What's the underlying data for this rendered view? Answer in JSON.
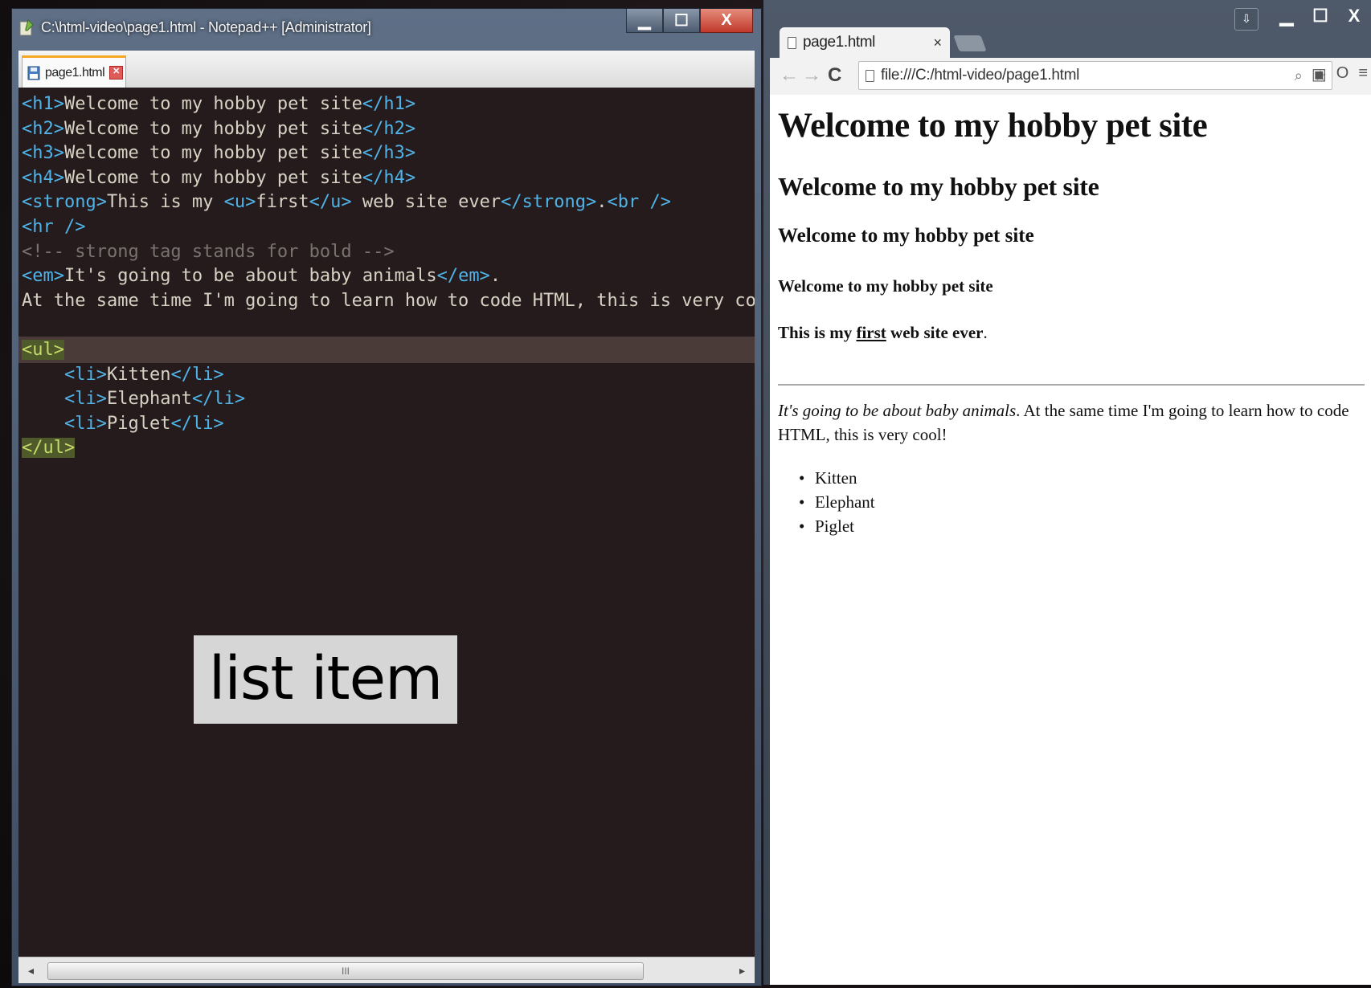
{
  "notepad": {
    "title": "C:\\html-video\\page1.html - Notepad++ [Administrator]",
    "tab_label": "page1.html",
    "code_lines": [
      [
        {
          "t": "<h1>",
          "c": "tag"
        },
        {
          "t": "Welcome to my hobby pet site"
        },
        {
          "t": "</h1>",
          "c": "tag"
        }
      ],
      [
        {
          "t": "<h2>",
          "c": "tag"
        },
        {
          "t": "Welcome to my hobby pet site"
        },
        {
          "t": "</h2>",
          "c": "tag"
        }
      ],
      [
        {
          "t": "<h3>",
          "c": "tag"
        },
        {
          "t": "Welcome to my hobby pet site"
        },
        {
          "t": "</h3>",
          "c": "tag"
        }
      ],
      [
        {
          "t": "<h4>",
          "c": "tag"
        },
        {
          "t": "Welcome to my hobby pet site"
        },
        {
          "t": "</h4>",
          "c": "tag"
        }
      ],
      [
        {
          "t": "<strong>",
          "c": "tag"
        },
        {
          "t": "This is my "
        },
        {
          "t": "<u>",
          "c": "tag"
        },
        {
          "t": "first"
        },
        {
          "t": "</u>",
          "c": "tag"
        },
        {
          "t": " web site ever"
        },
        {
          "t": "</strong>",
          "c": "tag"
        },
        {
          "t": "."
        },
        {
          "t": "<br />",
          "c": "tag"
        }
      ],
      [
        {
          "t": "<hr />",
          "c": "tag"
        }
      ],
      [
        {
          "t": "<!-- strong tag stands for bold -->",
          "c": "comment"
        }
      ],
      [
        {
          "t": "<em>",
          "c": "tag"
        },
        {
          "t": "It's going to be about baby animals"
        },
        {
          "t": "</em>",
          "c": "tag"
        },
        {
          "t": "."
        }
      ],
      [
        {
          "t": "At the same time I'm going to learn how to code HTML, this is very cool!"
        }
      ],
      [],
      [
        {
          "t": "<ul>",
          "c": "hl"
        }
      ],
      [
        {
          "t": "    "
        },
        {
          "t": "<li>",
          "c": "tag"
        },
        {
          "t": "Kitten"
        },
        {
          "t": "</li>",
          "c": "tag"
        }
      ],
      [
        {
          "t": "    "
        },
        {
          "t": "<li>",
          "c": "tag"
        },
        {
          "t": "Elephant"
        },
        {
          "t": "</li>",
          "c": "tag"
        }
      ],
      [
        {
          "t": "    "
        },
        {
          "t": "<li>",
          "c": "tag"
        },
        {
          "t": "Piglet"
        },
        {
          "t": "</li>",
          "c": "tag"
        }
      ],
      [
        {
          "t": "</ul>",
          "c": "hl"
        }
      ]
    ],
    "current_line": 10,
    "caption": "list item",
    "scroll_thumb": "III"
  },
  "browser": {
    "tab_label": "page1.html",
    "tab_close": "×",
    "url": "file:///C:/html-video/page1.html",
    "h1": "Welcome to my hobby pet site",
    "h2": "Welcome to my hobby pet site",
    "h3": "Welcome to my hobby pet site",
    "h4": "Welcome to my hobby pet site",
    "strong_before": "This is my ",
    "strong_underlined": "first",
    "strong_after": " web site ever",
    "strong_period": ".",
    "em_text": "It's going to be about baby animals",
    "para_rest": ". At the same time I'm going to learn how to code HTML, this is very cool!",
    "list_items": [
      "Kitten",
      "Elephant",
      "Piglet"
    ]
  },
  "icons": {
    "minimize": "minimize-icon",
    "maximize": "maximize-icon",
    "close": "close-icon",
    "back": "back-arrow-icon",
    "forward": "forward-arrow-icon",
    "reload": "reload-icon",
    "zoom": "zoom-icon",
    "star": "star-icon",
    "menu": "menu-icon"
  },
  "colors": {
    "editor_bg": "#251b1c",
    "tag": "#4fb3e8",
    "comment": "#7a7270",
    "brace_highlight": "#4f5a2a"
  }
}
